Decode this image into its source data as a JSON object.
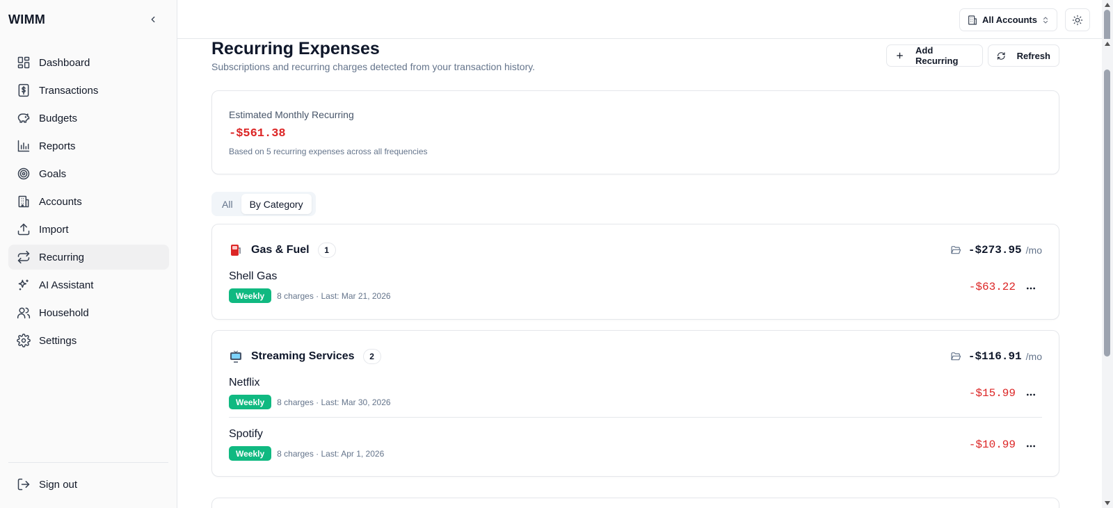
{
  "app": {
    "brand": "WIMM"
  },
  "sidebar": {
    "items": [
      {
        "label": "Dashboard",
        "icon": "dashboard-icon"
      },
      {
        "label": "Transactions",
        "icon": "dollar-receipt-icon"
      },
      {
        "label": "Budgets",
        "icon": "piggy-bank-icon"
      },
      {
        "label": "Reports",
        "icon": "bar-chart-icon"
      },
      {
        "label": "Goals",
        "icon": "target-icon"
      },
      {
        "label": "Accounts",
        "icon": "building-icon"
      },
      {
        "label": "Import",
        "icon": "upload-icon"
      },
      {
        "label": "Recurring",
        "icon": "repeat-icon",
        "active": true
      },
      {
        "label": "AI Assistant",
        "icon": "sparkles-icon"
      },
      {
        "label": "Household",
        "icon": "users-icon"
      },
      {
        "label": "Settings",
        "icon": "gear-icon"
      }
    ],
    "signout_label": "Sign out"
  },
  "topbar": {
    "account_selector": "All Accounts"
  },
  "header": {
    "title": "Recurring Expenses",
    "subtitle": "Subscriptions and recurring charges detected from your transaction history.",
    "add_label": "Add Recurring",
    "refresh_label": "Refresh"
  },
  "summary": {
    "label": "Estimated Monthly Recurring",
    "value": "-$561.38",
    "note": "Based on 5 recurring expenses across all frequencies"
  },
  "tabs": [
    {
      "label": "All",
      "selected": false
    },
    {
      "label": "By Category",
      "selected": true
    }
  ],
  "categories": [
    {
      "name": "Gas & Fuel",
      "count": "1",
      "total": "-$273.95",
      "per": "/mo",
      "items": [
        {
          "name": "Shell Gas",
          "frequency": "Weekly",
          "info": "8 charges · Last: Mar 21, 2026",
          "amount": "-$63.22"
        }
      ]
    },
    {
      "name": "Streaming Services",
      "count": "2",
      "total": "-$116.91",
      "per": "/mo",
      "items": [
        {
          "name": "Netflix",
          "frequency": "Weekly",
          "info": "8 charges · Last: Mar 30, 2026",
          "amount": "-$15.99"
        },
        {
          "name": "Spotify",
          "frequency": "Weekly",
          "info": "8 charges · Last: Apr 1, 2026",
          "amount": "-$10.99"
        }
      ]
    }
  ],
  "colors": {
    "negative": "#dc2626",
    "badge": "#10b981",
    "muted": "#64748b"
  }
}
